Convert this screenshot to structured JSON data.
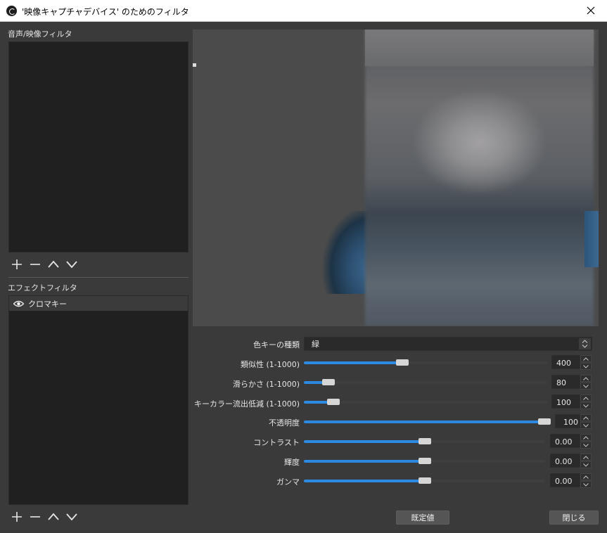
{
  "window": {
    "title": "'映像キャプチャデバイス' のためのフィルタ"
  },
  "audio_video_filters": {
    "label": "音声/映像フィルタ",
    "items": []
  },
  "effect_filters": {
    "label": "エフェクトフィルタ",
    "items": [
      {
        "label": "クロマキー",
        "visible": true
      }
    ]
  },
  "properties": {
    "key_color_type": {
      "label": "色キーの種類",
      "value": "緑"
    },
    "similarity": {
      "label": "類似性 (1-1000)",
      "value": "400",
      "fraction": 0.4
    },
    "smoothness": {
      "label": "滑らかさ (1-1000)",
      "value": "80",
      "fraction": 0.08
    },
    "spill": {
      "label": "キーカラー流出低減 (1-1000)",
      "value": "100",
      "fraction": 0.1
    },
    "opacity": {
      "label": "不透明度",
      "value": "100",
      "fraction": 1.0
    },
    "contrast": {
      "label": "コントラスト",
      "value": "0.00",
      "fraction": 0.5
    },
    "brightness": {
      "label": "輝度",
      "value": "0.00",
      "fraction": 0.5
    },
    "gamma": {
      "label": "ガンマ",
      "value": "0.00",
      "fraction": 0.5
    }
  },
  "buttons": {
    "defaults": "既定値",
    "close": "閉じる"
  },
  "icons": [
    "obs-logo-icon",
    "close-icon",
    "plus-icon",
    "minus-icon",
    "chevron-up-icon",
    "chevron-down-icon",
    "eye-icon",
    "updown-arrows-icon"
  ],
  "colors": {
    "accent": "#2d8ae3",
    "background": "#3a3a3a",
    "list_background": "#202020"
  }
}
